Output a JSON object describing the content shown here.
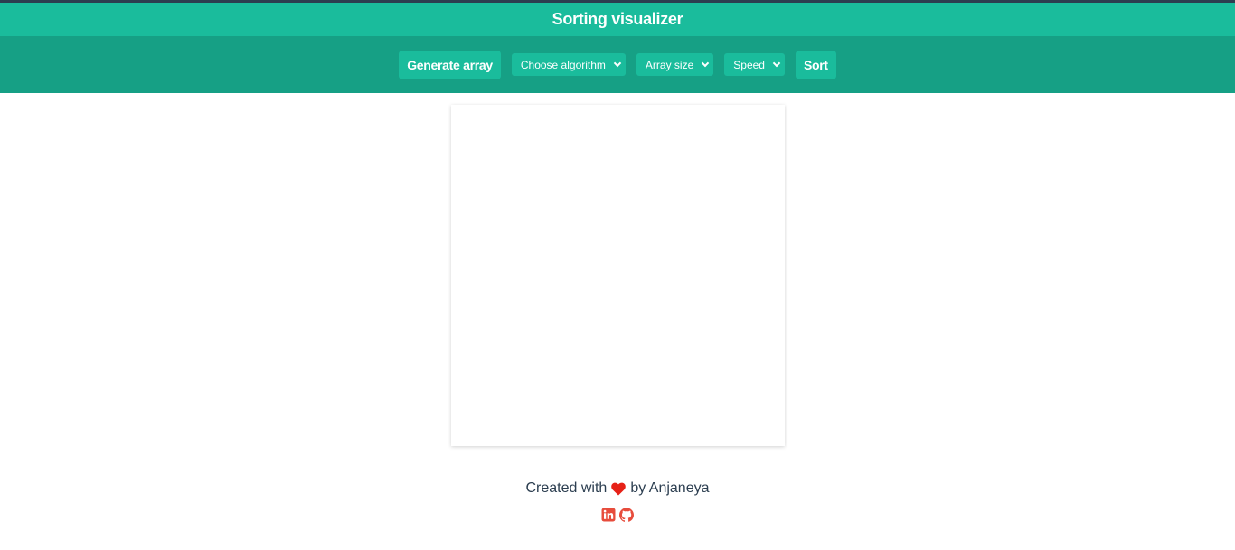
{
  "header": {
    "title": "Sorting visualizer"
  },
  "toolbar": {
    "generate_label": "Generate array",
    "algorithm_select": {
      "selected": "Choose algorithm"
    },
    "size_select": {
      "selected": "Array size"
    },
    "speed_select": {
      "selected": "Speed"
    },
    "sort_label": "Sort"
  },
  "footer": {
    "prefix": "Created with",
    "suffix": "by Anjaneya",
    "icons": [
      "linkedin-icon",
      "github-icon"
    ]
  },
  "colors": {
    "title_bar": "#1abc9c",
    "toolbar": "#16a085",
    "button": "#1abc9c",
    "heart": "#e62117",
    "social_icons": "#e74c3c",
    "text": "#2c3e50"
  }
}
